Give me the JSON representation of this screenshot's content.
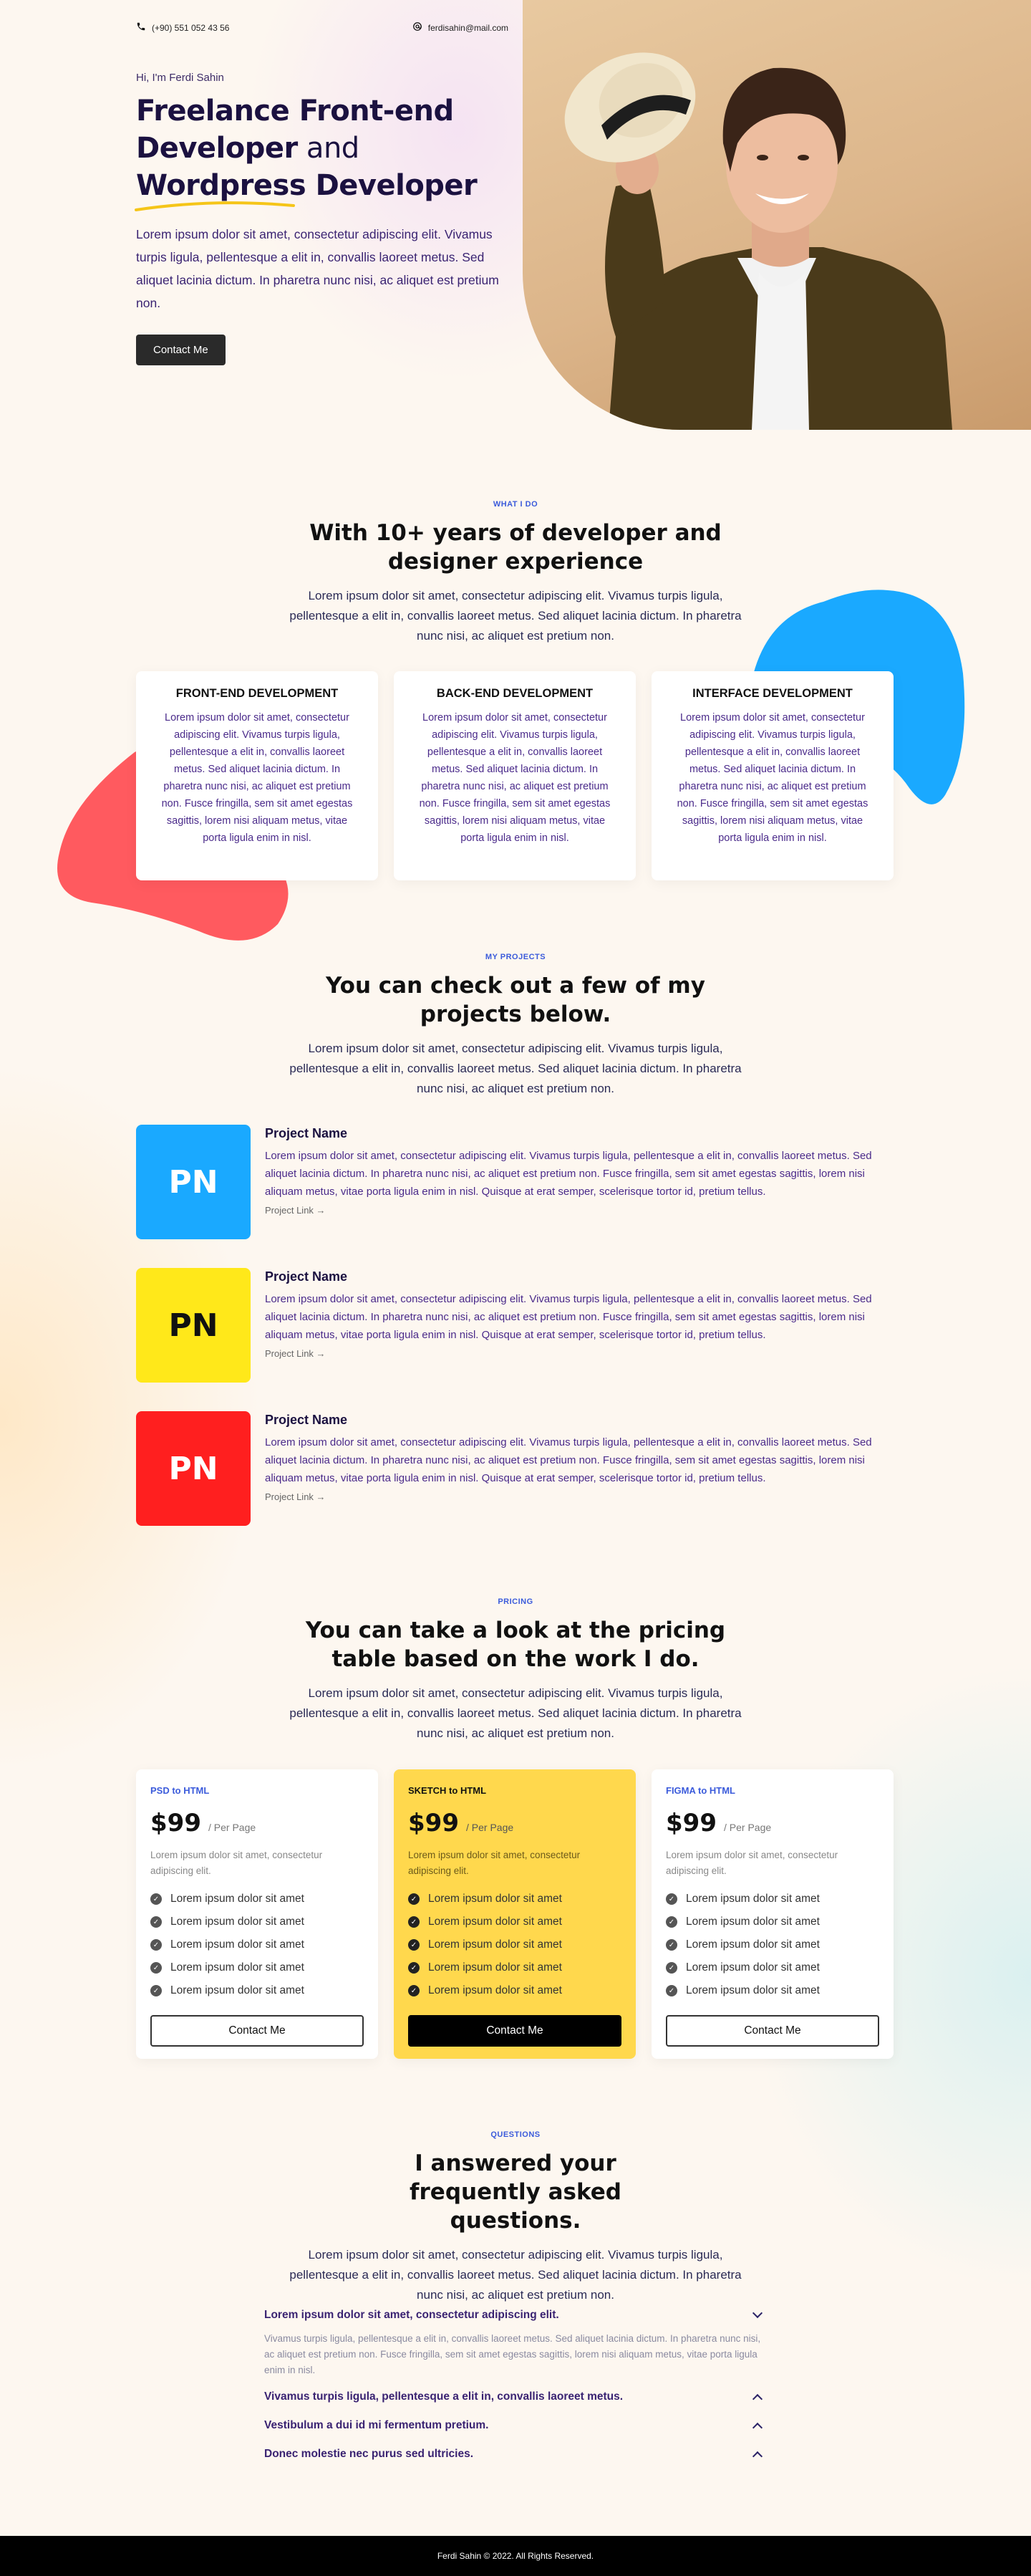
{
  "topbar": {
    "phone": "(+90) 551 052 43 56",
    "email": "ferdisahin@mail.com"
  },
  "hero": {
    "greeting": "Hi, I'm Ferdi Sahin",
    "title_line1": "Freelance Front-end",
    "title_line2_bold": "Developer",
    "title_line2_light": " and",
    "title_line3_underlined": "Wordpress",
    "title_line3_rest": " Developer",
    "description": "Lorem ipsum dolor sit amet, consectetur adipiscing elit. Vivamus turpis ligula, pellentesque a elit in, convallis laoreet metus. Sed aliquet lacinia dictum. In pharetra nunc nisi, ac aliquet est pretium non.",
    "cta": "Contact Me",
    "photo_bg_color": "#dcb58a",
    "underline_color": "#f5c518"
  },
  "services": {
    "eyebrow": "WHAT I DO",
    "title": "With 10+ years of developer and designer experience",
    "description": "Lorem ipsum dolor sit amet, consectetur adipiscing elit. Vivamus turpis ligula, pellentesque a elit in, convallis laoreet metus. Sed aliquet lacinia dictum. In pharetra nunc nisi, ac aliquet est pretium non.",
    "cards": [
      {
        "title": "FRONT-END DEVELOPMENT",
        "text": "Lorem ipsum dolor sit amet, consectetur adipiscing elit. Vivamus turpis ligula, pellentesque a elit in, convallis laoreet metus. Sed aliquet lacinia dictum. In pharetra nunc nisi, ac aliquet est pretium non. Fusce fringilla, sem sit amet egestas sagittis, lorem nisi aliquam metus, vitae porta ligula enim in nisl."
      },
      {
        "title": "BACK-END DEVELOPMENT",
        "text": "Lorem ipsum dolor sit amet, consectetur adipiscing elit. Vivamus turpis ligula, pellentesque a elit in, convallis laoreet metus. Sed aliquet lacinia dictum. In pharetra nunc nisi, ac aliquet est pretium non. Fusce fringilla, sem sit amet egestas sagittis, lorem nisi aliquam metus, vitae porta ligula enim in nisl."
      },
      {
        "title": "INTERFACE DEVELOPMENT",
        "text": "Lorem ipsum dolor sit amet, consectetur adipiscing elit. Vivamus turpis ligula, pellentesque a elit in, convallis laoreet metus. Sed aliquet lacinia dictum. In pharetra nunc nisi, ac aliquet est pretium non. Fusce fringilla, sem sit amet egestas sagittis, lorem nisi aliquam metus, vitae porta ligula enim in nisl."
      }
    ],
    "blob_colors": {
      "blue": "#1aa9ff",
      "red": "#ff5a5f"
    }
  },
  "projects": {
    "eyebrow": "MY PROJECTS",
    "title": "You can check out a few of my projects below.",
    "description": "Lorem ipsum dolor sit amet, consectetur adipiscing elit. Vivamus turpis ligula, pellentesque a elit in, convallis laoreet metus. Sed aliquet lacinia dictum. In pharetra nunc nisi, ac aliquet est pretium non.",
    "items": [
      {
        "initials": "PN",
        "color": "#1aa9ff",
        "text_color": "#ffffff",
        "name": "Project Name",
        "text": "Lorem ipsum dolor sit amet, consectetur adipiscing elit. Vivamus turpis ligula, pellentesque a elit in, convallis laoreet metus. Sed aliquet lacinia dictum. In pharetra nunc nisi, ac aliquet est pretium non. Fusce fringilla, sem sit amet egestas sagittis, lorem nisi aliquam metus, vitae porta ligula enim in nisl. Quisque at erat semper, scelerisque tortor id, pretium tellus.",
        "link": "Project Link →"
      },
      {
        "initials": "PN",
        "color": "#ffe81a",
        "text_color": "#111111",
        "name": "Project Name",
        "text": "Lorem ipsum dolor sit amet, consectetur adipiscing elit. Vivamus turpis ligula, pellentesque a elit in, convallis laoreet metus. Sed aliquet lacinia dictum. In pharetra nunc nisi, ac aliquet est pretium non. Fusce fringilla, sem sit amet egestas sagittis, lorem nisi aliquam metus, vitae porta ligula enim in nisl. Quisque at erat semper, scelerisque tortor id, pretium tellus.",
        "link": "Project Link →"
      },
      {
        "initials": "PN",
        "color": "#ff1f1f",
        "text_color": "#ffffff",
        "name": "Project Name",
        "text": "Lorem ipsum dolor sit amet, consectetur adipiscing elit. Vivamus turpis ligula, pellentesque a elit in, convallis laoreet metus. Sed aliquet lacinia dictum. In pharetra nunc nisi, ac aliquet est pretium non. Fusce fringilla, sem sit amet egestas sagittis, lorem nisi aliquam metus, vitae porta ligula enim in nisl. Quisque at erat semper, scelerisque tortor id, pretium tellus.",
        "link": "Project Link →"
      }
    ]
  },
  "pricing": {
    "eyebrow": "PRICING",
    "title": "You can take a look at the pricing table based on the work I do.",
    "description": "Lorem ipsum dolor sit amet, consectetur adipiscing elit. Vivamus turpis ligula, pellentesque a elit in, convallis laoreet metus. Sed aliquet lacinia dictum. In pharetra nunc nisi, ac aliquet est pretium non.",
    "plans": [
      {
        "name": "PSD to HTML",
        "price": "$99",
        "per": "/ Per Page",
        "desc": "Lorem ipsum dolor sit amet, consectetur adipiscing elit.",
        "features": [
          "Lorem ipsum dolor sit amet",
          "Lorem ipsum dolor sit amet",
          "Lorem ipsum dolor sit amet",
          "Lorem ipsum dolor sit amet",
          "Lorem ipsum dolor sit amet"
        ],
        "cta": "Contact Me",
        "highlighted": false
      },
      {
        "name": "SKETCH to HTML",
        "price": "$99",
        "per": "/ Per Page",
        "desc": "Lorem ipsum dolor sit amet, consectetur adipiscing elit.",
        "features": [
          "Lorem ipsum dolor sit amet",
          "Lorem ipsum dolor sit amet",
          "Lorem ipsum dolor sit amet",
          "Lorem ipsum dolor sit amet",
          "Lorem ipsum dolor sit amet"
        ],
        "cta": "Contact Me",
        "highlighted": true
      },
      {
        "name": "FIGMA to HTML",
        "price": "$99",
        "per": "/ Per Page",
        "desc": "Lorem ipsum dolor sit amet, consectetur adipiscing elit.",
        "features": [
          "Lorem ipsum dolor sit amet",
          "Lorem ipsum dolor sit amet",
          "Lorem ipsum dolor sit amet",
          "Lorem ipsum dolor sit amet",
          "Lorem ipsum dolor sit amet"
        ],
        "cta": "Contact Me",
        "highlighted": false
      }
    ],
    "highlight_color": "#ffd84d"
  },
  "faq": {
    "eyebrow": "QUESTIONS",
    "title": "I answered your frequently asked questions.",
    "description": "Lorem ipsum dolor sit amet, consectetur adipiscing elit. Vivamus turpis ligula, pellentesque a elit in, convallis laoreet metus. Sed aliquet lacinia dictum. In pharetra nunc nisi, ac aliquet est pretium non.",
    "items": [
      {
        "q": "Lorem ipsum dolor sit amet, consectetur adipiscing elit.",
        "a": "Vivamus turpis ligula, pellentesque a elit in, convallis laoreet metus. Sed aliquet lacinia dictum. In pharetra nunc nisi, ac aliquet est pretium non. Fusce fringilla, sem sit amet egestas sagittis, lorem nisi aliquam metus, vitae porta ligula enim in nisl.",
        "open": true
      },
      {
        "q": "Vivamus turpis ligula, pellentesque a elit in, convallis laoreet metus.",
        "a": "",
        "open": false
      },
      {
        "q": "Vestibulum a dui id mi fermentum pretium.",
        "a": "",
        "open": false
      },
      {
        "q": "Donec molestie nec purus sed ultricies.",
        "a": "",
        "open": false
      }
    ]
  },
  "footer": {
    "text": "Ferdi Sahin © 2022. All Rights Reserved."
  }
}
